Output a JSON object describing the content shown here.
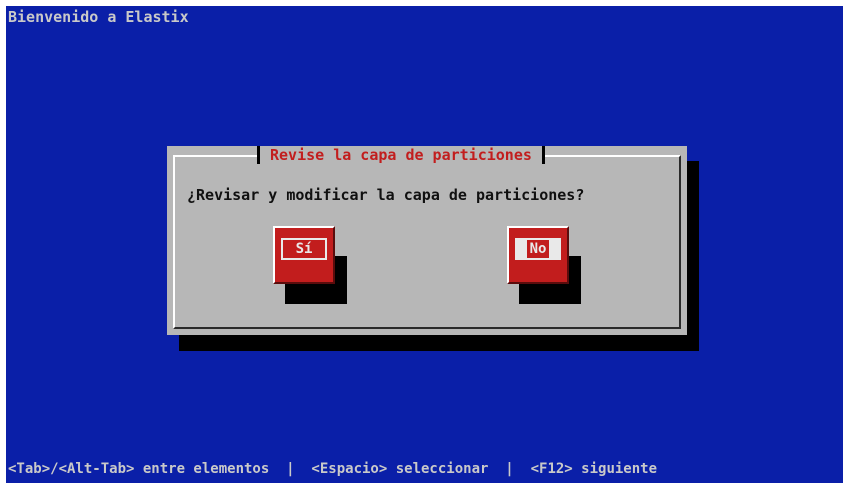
{
  "screen": {
    "root_title": "Bienvenido a Elastix",
    "background_color": "#0a1fa8"
  },
  "dialog": {
    "title": "Revise la capa de particiones",
    "question": "¿Revisar y modificar la capa de particiones?",
    "buttons": {
      "yes_label": "Sí",
      "no_label": "No",
      "focused": "No"
    },
    "button_color": "#c21d1d",
    "panel_color": "#b7b7b7"
  },
  "status_bar": {
    "text": "<Tab>/<Alt-Tab> entre elementos  |  <Espacio> seleccionar  |  <F12> siguiente"
  }
}
